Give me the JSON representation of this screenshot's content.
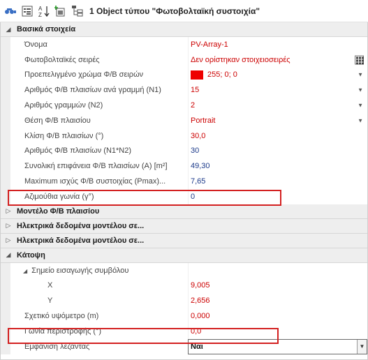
{
  "toolbar": {
    "title": "1 Object  τύπου \"Φωτοβολταϊκή συστοιχία\"",
    "icons": [
      "filter-icon",
      "categorized-icon",
      "sort-az-icon",
      "add-object-icon",
      "tree-view-icon"
    ]
  },
  "categories": {
    "basic": "Βασικά στοιχεία",
    "model": "Μοντέλο Φ/Β πλαισίου",
    "elec1": "Ηλεκτρικά δεδομένα μοντέλου σε...",
    "elec2": "Ηλεκτρικά δεδομένα μοντέλου σε...",
    "plan": "Κάτοψη"
  },
  "rows": {
    "name": {
      "label": "Όνομα",
      "value": "PV-Array-1"
    },
    "strings": {
      "label": "Φωτοβολταϊκές σειρές",
      "value": "Δεν ορίστηκαν στοιχειοσειρές"
    },
    "color": {
      "label": "Προεπελιγμένο χρώμα Φ/Β σειρών",
      "value": "255; 0; 0",
      "swatch": "#ee0000"
    },
    "per_row": {
      "label": "Αριθμός Φ/Β πλαισίων ανά γραμμή (N1)",
      "value": "15"
    },
    "lines": {
      "label": "Αριθμός γραμμών (N2)",
      "value": "2"
    },
    "position": {
      "label": "Θέση Φ/Β πλαισίου",
      "value": "Portrait"
    },
    "tilt": {
      "label": "Κλίση Φ/Β πλαισίων (°)",
      "value": "30,0"
    },
    "count": {
      "label": "Αριθμός Φ/Β πλαισίων (N1*N2)",
      "value": "30"
    },
    "area": {
      "label": "Συνολική επιφάνεια Φ/Β πλαισίων (A) [m²]",
      "value": "49,30"
    },
    "power": {
      "label": "Maximum ισχύς Φ/Β συστοιχίας (Pmax)...",
      "value": "7,65"
    },
    "azimuth": {
      "label": "Αζιμούθια γωνία (γ°)",
      "value": "0"
    },
    "insertion_point": {
      "label": "Σημείο εισαγωγής συμβόλου"
    },
    "x": {
      "label": "X",
      "value": "9,005"
    },
    "y": {
      "label": "Y",
      "value": "2,656"
    },
    "elevation": {
      "label": "Σχετικό υψόμετρο (m)",
      "value": "0,000"
    },
    "rotation": {
      "label": "Γωνία περιστροφής (°)",
      "value": "0,0"
    },
    "legend": {
      "label": "Εμφάνιση λεζάντας",
      "value": "Ναι"
    }
  },
  "colors": {
    "highlight": "#d32020",
    "value_text": "#1c3a8a",
    "link_red": "#cc0000"
  }
}
